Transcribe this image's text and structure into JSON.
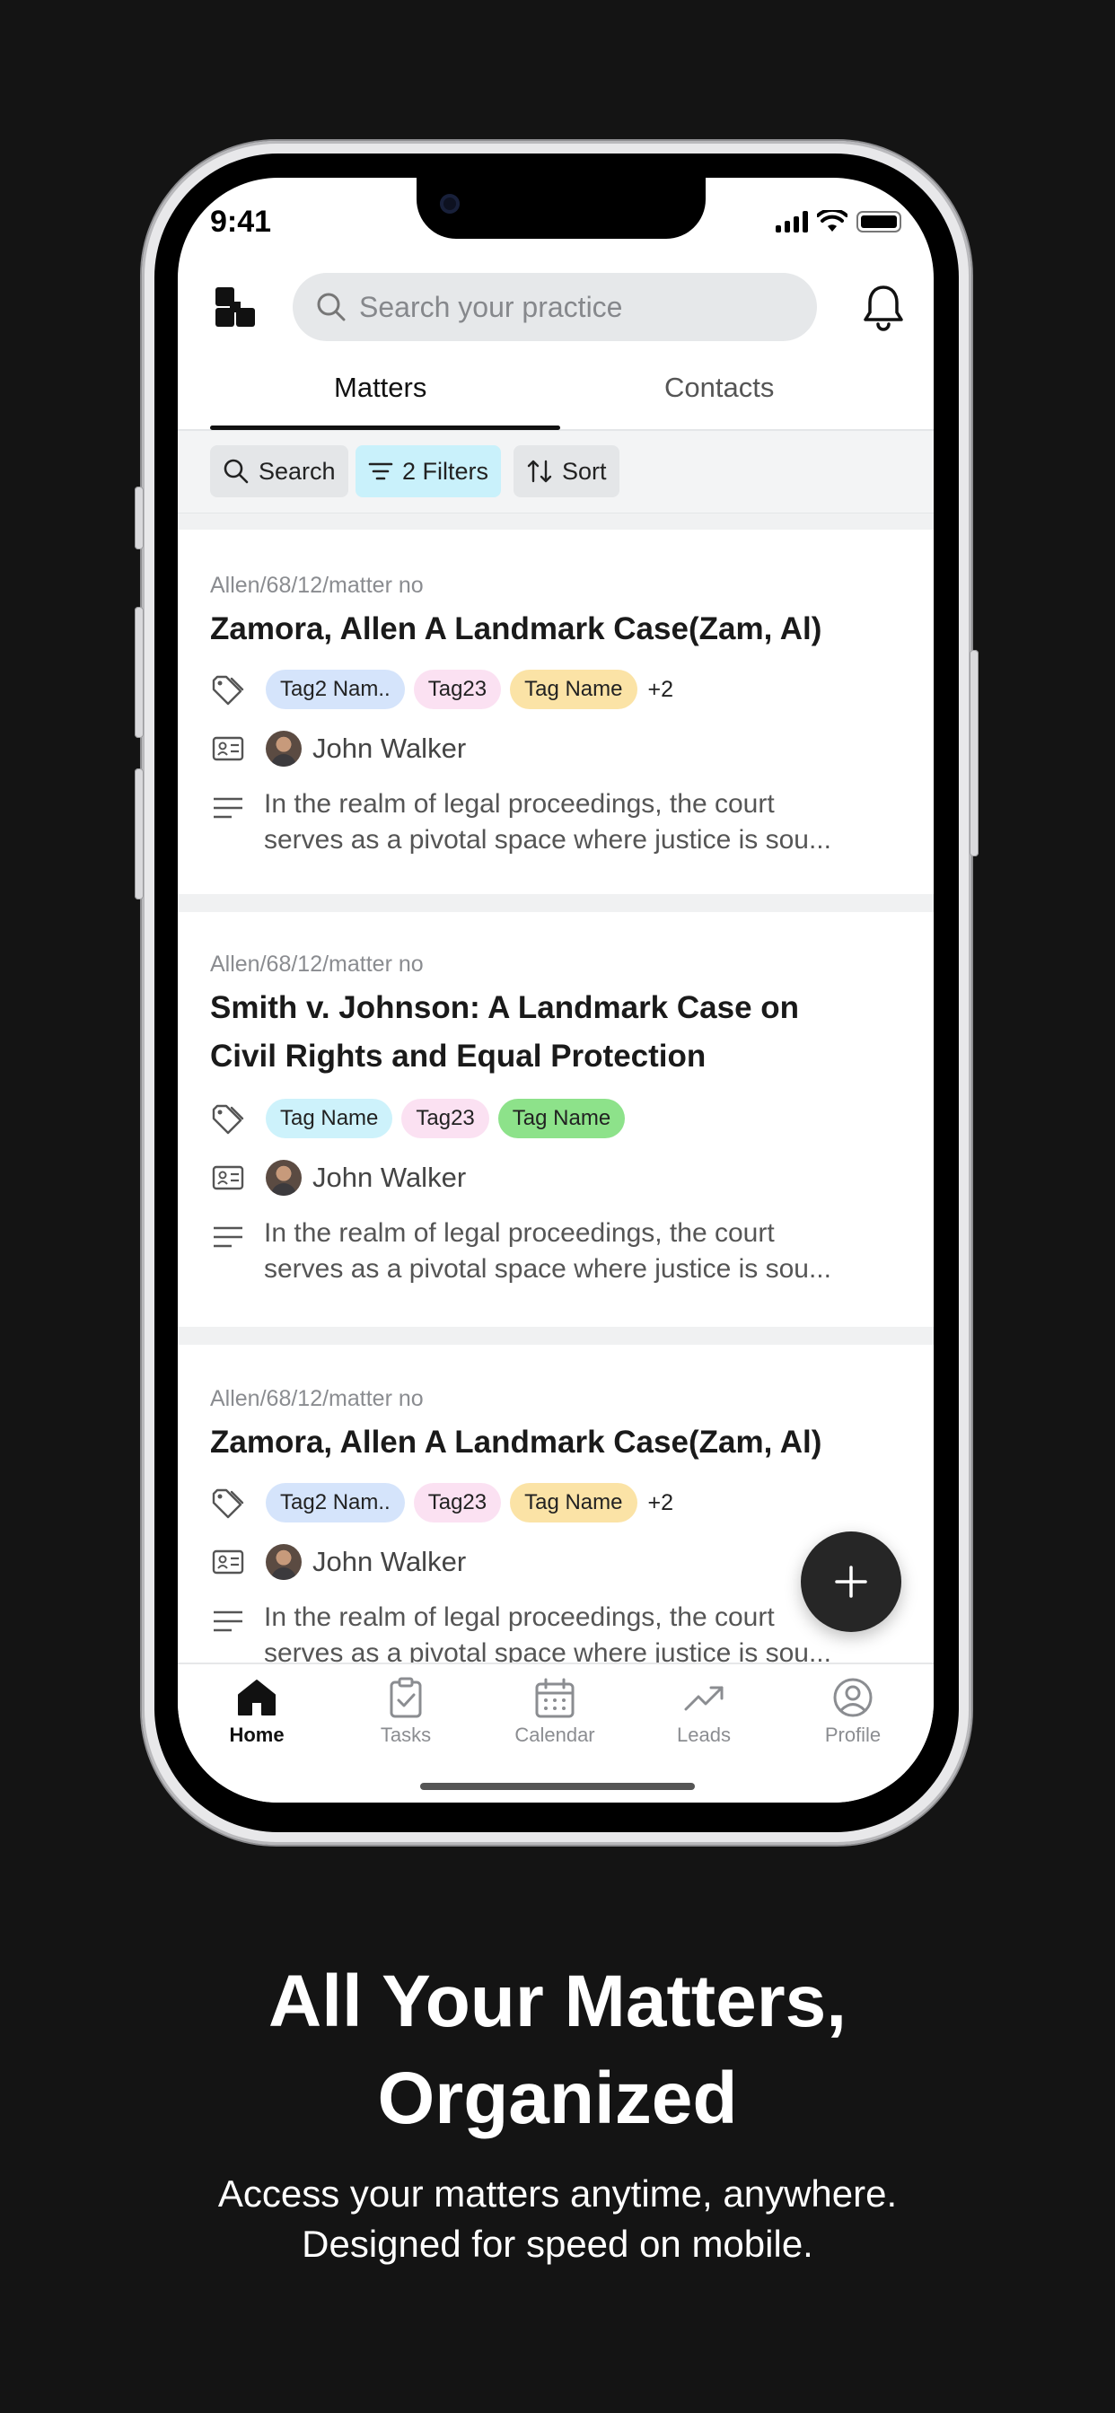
{
  "status_bar": {
    "time": "9:41"
  },
  "header": {
    "search_placeholder": "Search your practice"
  },
  "tabs": [
    {
      "label": "Matters",
      "active": true
    },
    {
      "label": "Contacts",
      "active": false
    }
  ],
  "toolbar": {
    "search_label": "Search",
    "filters_label": "2 Filters",
    "sort_label": "Sort"
  },
  "matters": [
    {
      "matter_no": "Allen/68/12/matter no",
      "title": "Zamora, Allen A Landmark Case(Zam, Al)",
      "tags": [
        {
          "label": "Tag2 Nam..",
          "color": "#d5e4fb"
        },
        {
          "label": "Tag23",
          "color": "#fbe1f2"
        },
        {
          "label": "Tag Name",
          "color": "#fbe3a6"
        }
      ],
      "more_tags": "+2",
      "person": "John Walker",
      "description_line1": "In the realm of legal proceedings, the court",
      "description_line2": "serves as a pivotal space where justice is sou..."
    },
    {
      "matter_no": "Allen/68/12/matter no",
      "title_line1": "Smith v. Johnson: A Landmark Case on",
      "title_line2": "Civil Rights and Equal Protection",
      "tags": [
        {
          "label": "Tag Name",
          "color": "#cdf2fb"
        },
        {
          "label": "Tag23",
          "color": "#fbe1f2"
        },
        {
          "label": "Tag Name",
          "color": "#8de28a"
        }
      ],
      "person": "John Walker",
      "description_line1": "In the realm of legal proceedings, the court",
      "description_line2": "serves as a pivotal space where justice is sou..."
    },
    {
      "matter_no": "Allen/68/12/matter no",
      "title": "Zamora, Allen A Landmark Case(Zam, Al)",
      "tags": [
        {
          "label": "Tag2 Nam..",
          "color": "#d5e4fb"
        },
        {
          "label": "Tag23",
          "color": "#fbe1f2"
        },
        {
          "label": "Tag Name",
          "color": "#fbe3a6"
        }
      ],
      "more_tags": "+2",
      "person": "John Walker",
      "description_line1": "In the realm of legal proceedings, the court",
      "description_line2": "serves as a pivotal space where justice is sou..."
    }
  ],
  "fab": {
    "icon": "plus-icon"
  },
  "bottom_nav": [
    {
      "label": "Home",
      "icon": "home-icon",
      "active": true
    },
    {
      "label": "Tasks",
      "icon": "clipboard-check-icon",
      "active": false
    },
    {
      "label": "Calendar",
      "icon": "calendar-icon",
      "active": false
    },
    {
      "label": "Leads",
      "icon": "trending-up-icon",
      "active": false
    },
    {
      "label": "Profile",
      "icon": "user-circle-icon",
      "active": false
    }
  ],
  "marketing": {
    "headline_line1": "All Your Matters,",
    "headline_line2": "Organized",
    "subline_line1": "Access your matters anytime, anywhere.",
    "subline_line2": "Designed for speed on mobile."
  },
  "colors": {
    "background": "#141414",
    "filter_chip_active": "#c9f1fb",
    "fab": "#262626"
  }
}
